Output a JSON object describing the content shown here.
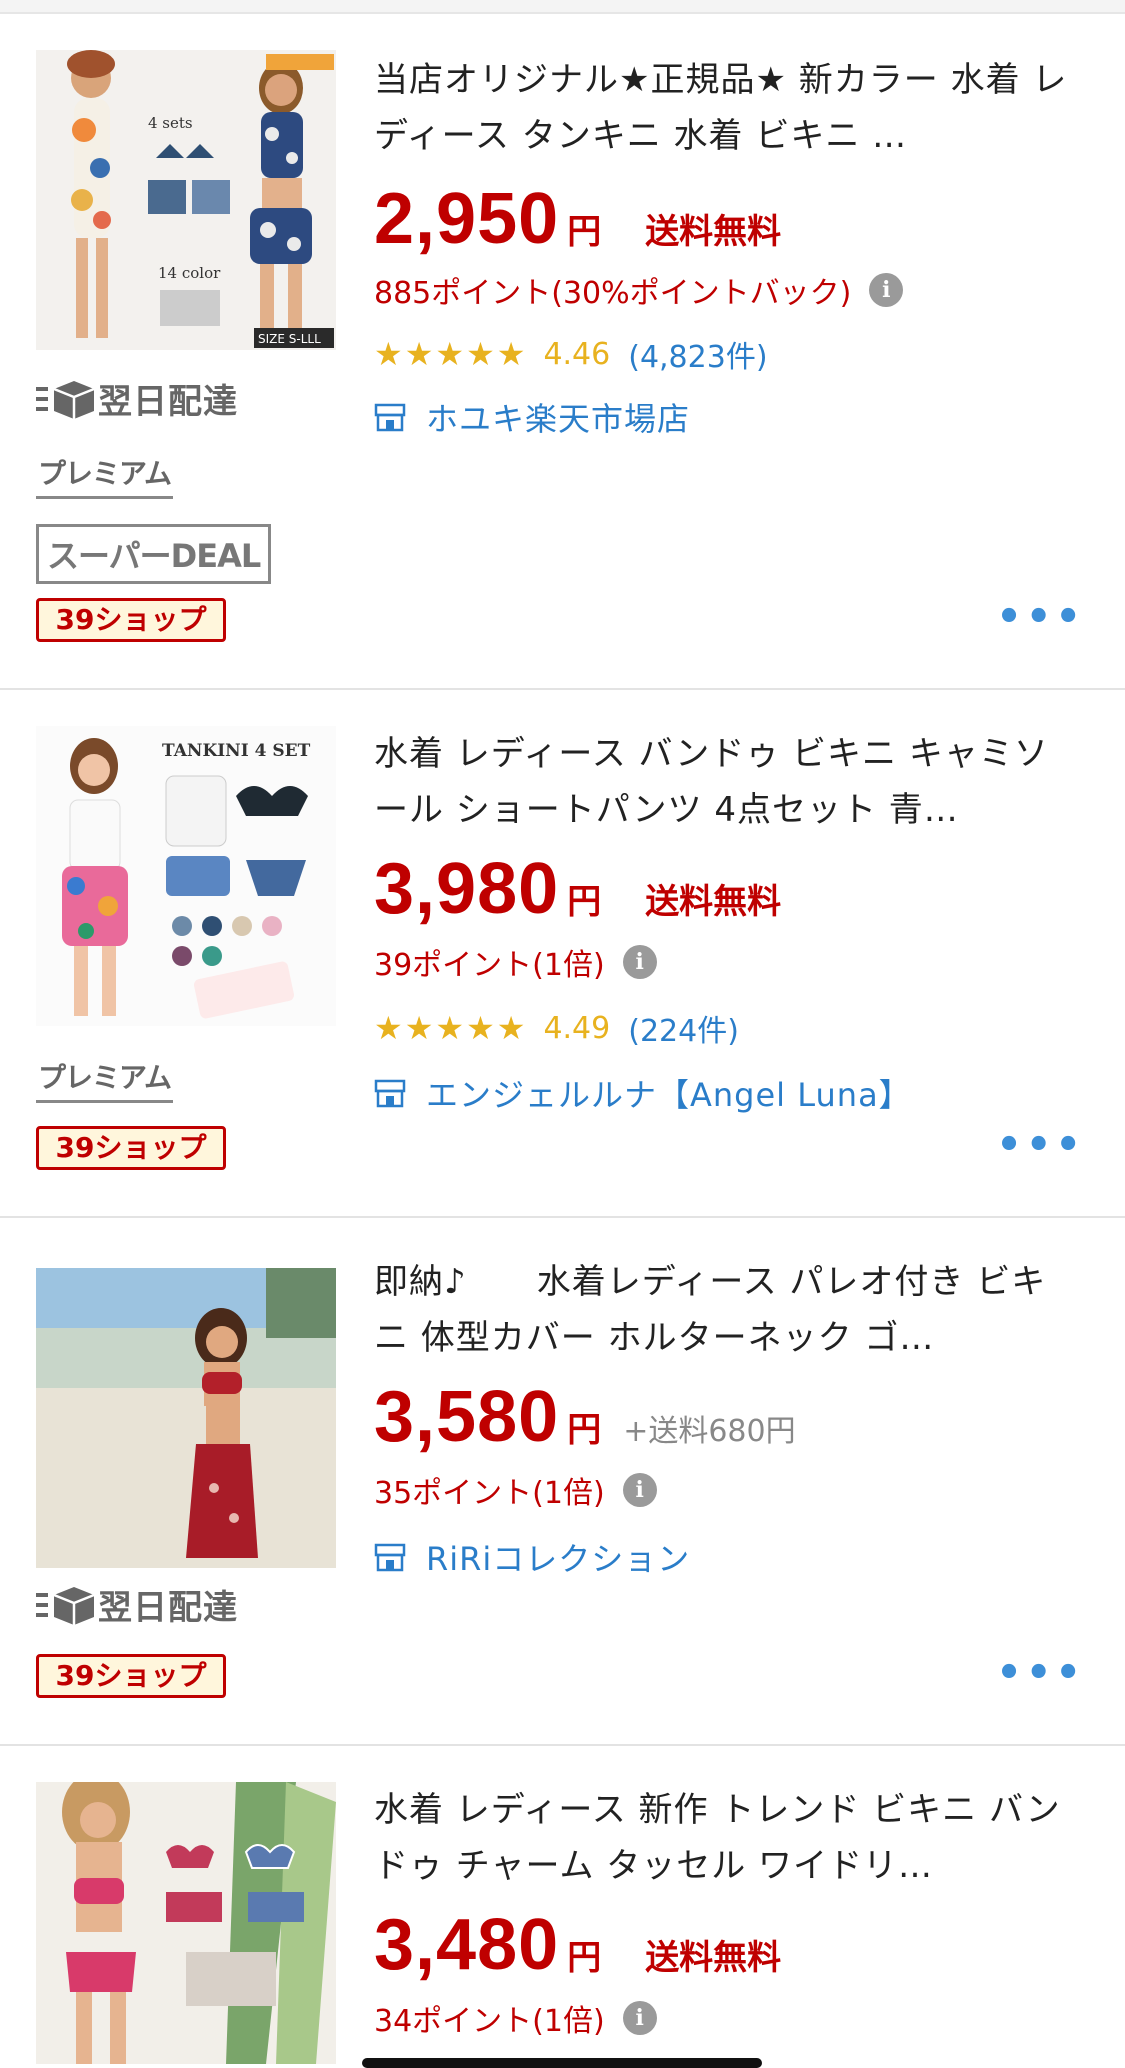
{
  "products": [
    {
      "title": "当店オリジナル★正規品★ 新カラー 水着 レディース タンキニ 水着 ビキニ …",
      "price": "2,950",
      "yen": "円",
      "shipping": "送料無料",
      "points": "885ポイント(30%ポイントバック)",
      "stars": "★★★★★",
      "rating": "4.46",
      "review_count": "(4,823件)",
      "shop": "ホユキ楽天市場店",
      "thumb_text": {
        "sets": "4 sets",
        "colors": "14 color",
        "size": "SIZE S-LLL"
      },
      "badges": {
        "delivery": "翌日配達",
        "premium": "プレミアム",
        "deal": "スーパーDEAL",
        "shop39": "39ショップ"
      }
    },
    {
      "title": "水着 レディース バンドゥ ビキニ キャミソール ショートパンツ 4点セット 青…",
      "price": "3,980",
      "yen": "円",
      "shipping": "送料無料",
      "points": "39ポイント(1倍)",
      "stars": "★★★★★",
      "rating": "4.49",
      "review_count": "(224件)",
      "shop": "エンジェルルナ【Angel Luna】",
      "thumb_text": {
        "sets": "TANKINI 4 SET"
      },
      "badges": {
        "premium": "プレミアム",
        "shop39": "39ショップ"
      }
    },
    {
      "title": "即納♪　　水着レディース パレオ付き ビキニ 体型カバー ホルターネック ゴ…",
      "price": "3,580",
      "yen": "円",
      "shipping_cost": "+送料680円",
      "points": "35ポイント(1倍)",
      "shop": "RiRiコレクション",
      "badges": {
        "delivery": "翌日配達",
        "shop39": "39ショップ"
      }
    },
    {
      "title": "水着 レディース 新作 トレンド ビキニ バンドゥ チャーム タッセル ワイドリ…",
      "price": "3,480",
      "yen": "円",
      "shipping": "送料無料",
      "points": "34ポイント(1倍)"
    }
  ],
  "more_label": "•••",
  "info_label": "i"
}
